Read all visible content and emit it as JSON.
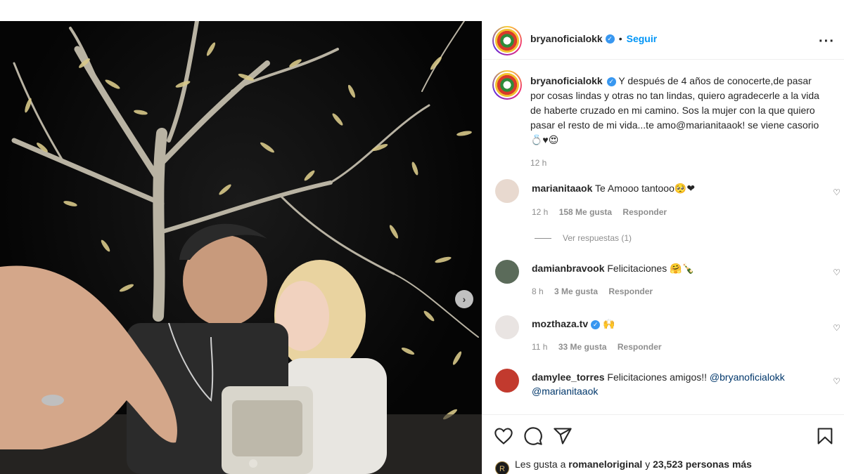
{
  "post": {
    "username": "bryanoficialokk",
    "follow_label": "Seguir",
    "separator": "•",
    "more_label": "···",
    "caption": "Y después de 4 años de conocerte,de pasar por cosas lindas y otras no tan lindas, quiero agradecerle a la vida de haberte cruzado en mi camino. Sos la mujer con la que quiero pasar el resto de mi vida...te amo@marianitaaok! se viene casorio",
    "caption_emojis": "💍♥😍",
    "time": "12 h"
  },
  "comments": [
    {
      "username": "marianitaaok",
      "text": "Te Amooo tantooo",
      "emojis": "🥺❤",
      "time": "12 h",
      "likes": "158 Me gusta",
      "reply": "Responder",
      "avatar_color": "#e8d9cf"
    },
    {
      "username": "damianbravook",
      "text": "Felicitaciones",
      "emojis": "🤗🍾",
      "time": "8 h",
      "likes": "3 Me gusta",
      "reply": "Responder",
      "avatar_color": "#5b6b5a"
    },
    {
      "username": "mozthaza.tv",
      "text": "",
      "emojis": "🙌",
      "time": "11 h",
      "likes": "33 Me gusta",
      "reply": "Responder",
      "avatar_color": "#e9e4e2"
    },
    {
      "username": "damylee_torres",
      "text": "Felicitaciones amigos!!",
      "mention1": "@bryanoficialokk",
      "mention2": "@marianitaaok",
      "avatar_color": "#c23a2e"
    }
  ],
  "view_replies": "Ver respuestas (1)",
  "likes": {
    "prefix": "Les gusta a",
    "user": "romaneloriginal",
    "middle": "y",
    "count": "23,523 personas más",
    "avatar_letter": "R"
  },
  "colors": {
    "accent": "#0095f6",
    "verified": "#3897f0",
    "muted": "#8e8e8e",
    "text": "#262626"
  }
}
